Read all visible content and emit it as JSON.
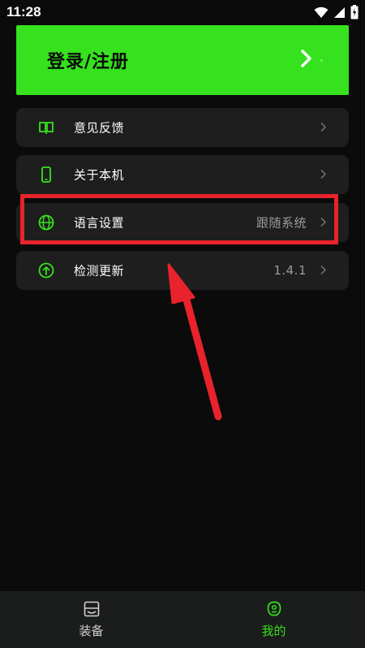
{
  "status_bar": {
    "time": "11:28",
    "icons": [
      "wifi-icon",
      "signal-icon",
      "battery-icon"
    ]
  },
  "login": {
    "label": "登录/注册",
    "icon": "chevron-right-icon"
  },
  "menu": {
    "items": [
      {
        "label": "意见反馈",
        "icon": "feedback-book-icon",
        "value": ""
      },
      {
        "label": "关于本机",
        "icon": "phone-icon",
        "value": ""
      },
      {
        "label": "语言设置",
        "icon": "globe-icon",
        "value": "跟随系统"
      },
      {
        "label": "检测更新",
        "icon": "update-arrow-icon",
        "value": "1.4.1"
      }
    ]
  },
  "bottom_nav": {
    "tabs": [
      {
        "label": "装备",
        "icon": "equipment-icon",
        "active": false
      },
      {
        "label": "我的",
        "icon": "profile-icon",
        "active": true
      }
    ]
  },
  "colors": {
    "accent": "#35e21d",
    "background": "#0b0b0b",
    "card": "#1e1e1e",
    "annotation": "#e8232b"
  }
}
